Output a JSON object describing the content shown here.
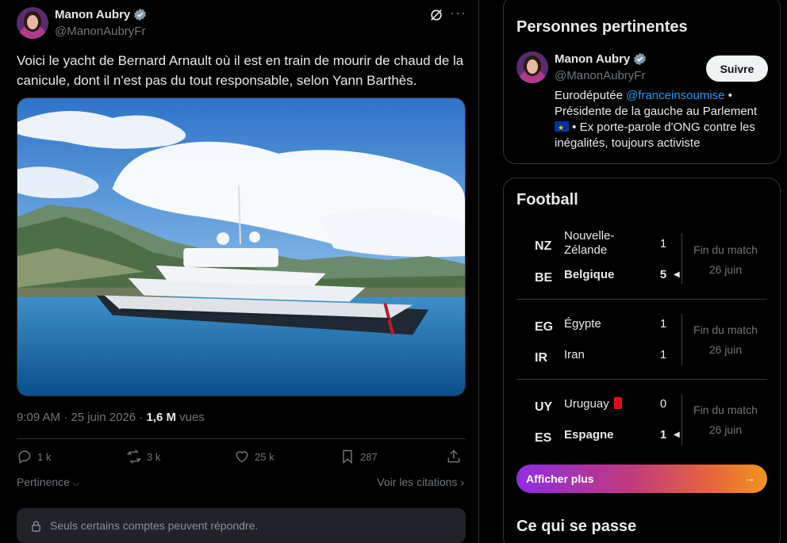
{
  "tweet": {
    "author_name": "Manon Aubry",
    "author_handle": "@ManonAubryFr",
    "text": "Voici le yacht de Bernard Arnault où il est en train de mourir de chaud de la canicule, dont il n'est pas du tout responsable, selon Yann Barthès.",
    "time": "9:09 AM · 25 juin 2026 · ",
    "views_count": "1,6 M",
    "views_label": " vues",
    "replies": "1 k",
    "reposts": "3 k",
    "likes": "25 k",
    "bookmarks": "287",
    "sort_label": "Pertinence",
    "quotes_label": "Voir les citations",
    "reply_restriction": "Seuls certains comptes peuvent répondre."
  },
  "people": {
    "title": "Personnes pertinentes",
    "name": "Manon Aubry",
    "handle": "@ManonAubryFr",
    "follow_label": "Suivre",
    "bio_1": "Eurodéputée ",
    "bio_mention": "@franceinsoumise",
    "bio_2": " • Présidente de la gauche au Parlement ",
    "bio_3": " • Ex porte-parole d'ONG contre les inégalités, toujours activiste"
  },
  "football": {
    "title": "Football",
    "matches": [
      {
        "home_code": "NZ",
        "home_name": "Nouvelle-Zélande",
        "home_score": "1",
        "away_code": "BE",
        "away_name": "Belgique",
        "away_score": "5",
        "status": "Fin du match",
        "date": "26 juin"
      },
      {
        "home_code": "EG",
        "home_name": "Égypte",
        "home_score": "1",
        "away_code": "IR",
        "away_name": "Iran",
        "away_score": "1",
        "status": "Fin du match",
        "date": "26 juin"
      },
      {
        "home_code": "UY",
        "home_name": "Uruguay",
        "home_score": "0",
        "away_code": "ES",
        "away_name": "Espagne",
        "away_score": "1",
        "status": "Fin du match",
        "date": "26 juin"
      }
    ],
    "show_more_label": "Afficher plus"
  },
  "next_section_title": "Ce qui se passe",
  "colors": {
    "background": "#000000",
    "text": "#e7e9ea",
    "muted": "#71767b",
    "link": "#1d9bf0",
    "verified": "#829aab",
    "border": "#2f3336"
  },
  "icons": [
    "verified-badge-icon",
    "grok-icon",
    "more-icon",
    "reply-icon",
    "repost-icon",
    "like-icon",
    "bookmark-icon",
    "share-icon",
    "chevron-down-icon",
    "chevron-right-icon",
    "lock-icon",
    "arrow-right-icon",
    "winner-arrow-icon",
    "red-card-icon",
    "eu-flag-icon"
  ]
}
